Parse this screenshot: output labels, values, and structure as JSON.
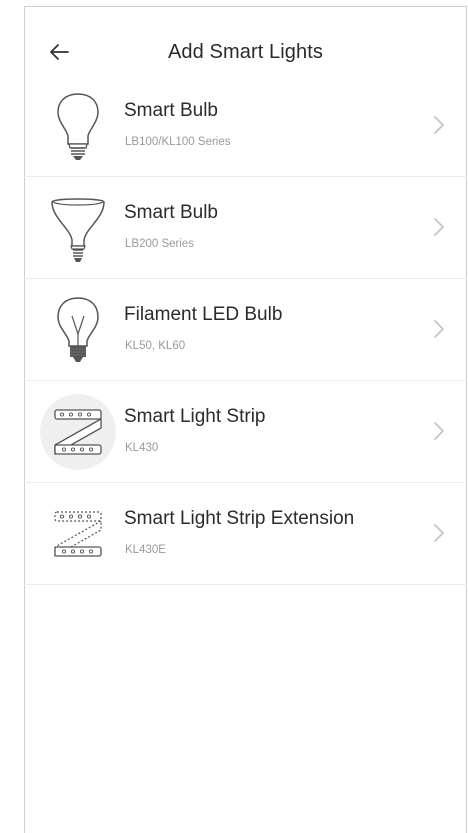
{
  "header": {
    "title": "Add Smart Lights",
    "back_icon": "arrow-left-icon"
  },
  "products": [
    {
      "name": "Smart Bulb",
      "model": "LB100/KL100 Series",
      "icon": "a19-bulb-icon"
    },
    {
      "name": "Smart Bulb",
      "model": "LB200 Series",
      "icon": "br30-bulb-icon"
    },
    {
      "name": "Filament LED Bulb",
      "model": "KL50, KL60",
      "icon": "filament-bulb-icon"
    },
    {
      "name": "Smart Light Strip",
      "model": "KL430",
      "icon": "light-strip-icon"
    },
    {
      "name": "Smart Light Strip Extension",
      "model": "KL430E",
      "icon": "light-strip-extension-icon"
    }
  ],
  "colors": {
    "text": "#2b2b2b",
    "subtext": "#9a9a9a",
    "chevron": "#c4c4c4",
    "divider": "#ececec",
    "icon_stroke": "#555555"
  }
}
